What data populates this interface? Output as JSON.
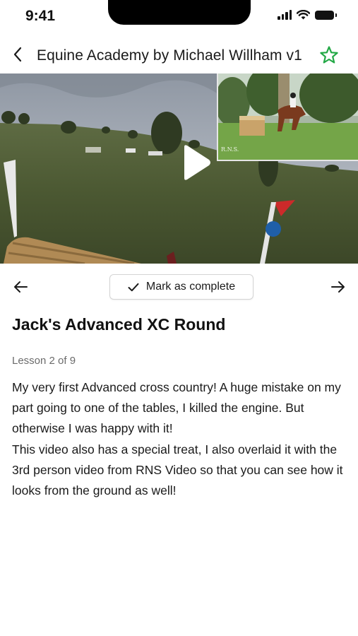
{
  "status_bar": {
    "time": "9:41",
    "icons": [
      "cellular-signal-icon",
      "wifi-icon",
      "battery-icon"
    ]
  },
  "header": {
    "back_icon": "chevron-left-icon",
    "title": "Equine Academy by Michael Willham v1",
    "favorite_icon": "star-outline-icon",
    "accent_color": "#22a845"
  },
  "video": {
    "play_icon": "play-icon",
    "pip_watermark": "R.N.S."
  },
  "controls": {
    "prev_icon": "arrow-left-icon",
    "next_icon": "arrow-right-icon",
    "complete_icon": "checkmark-icon",
    "complete_label": "Mark as complete"
  },
  "lesson": {
    "title": "Jack's Advanced XC Round",
    "progress": "Lesson 2 of 9",
    "description": [
      "My very first Advanced cross country! A huge mistake on my part going to one of the tables, I killed the engine. But otherwise I was happy with it!",
      "This video also has a special treat, I also overlaid it with the 3rd person video from RNS Video so that you can see how it looks from the ground as well!"
    ]
  }
}
